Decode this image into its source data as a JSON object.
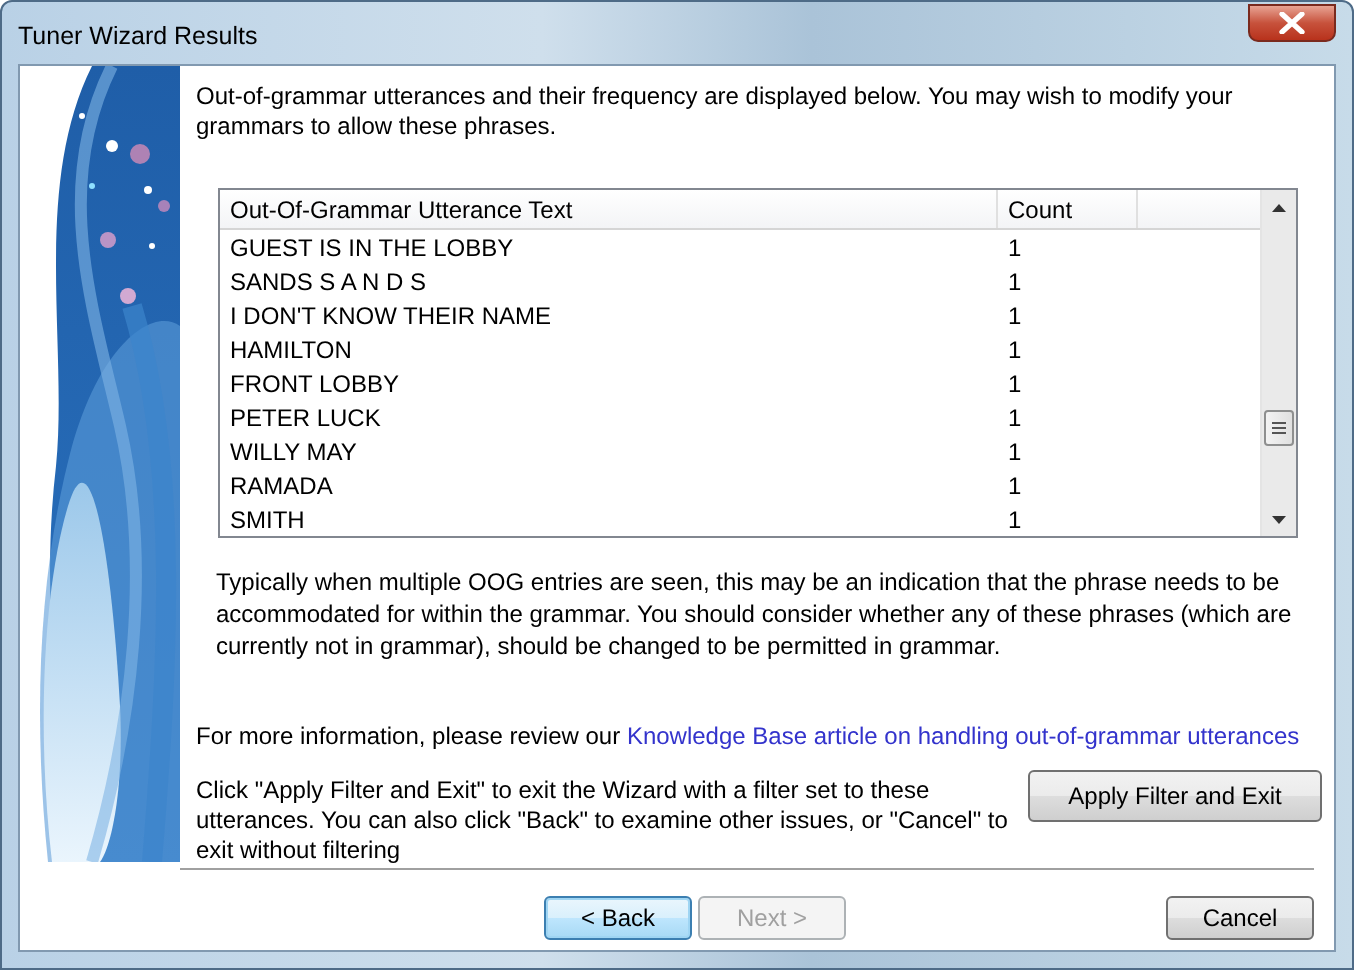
{
  "window": {
    "title": "Tuner Wizard Results"
  },
  "intro": "Out-of-grammar utterances and their frequency are displayed below. You may wish to modify your grammars to allow these phrases.",
  "table": {
    "columns": [
      "Out-Of-Grammar Utterance Text",
      "Count"
    ],
    "rows": [
      {
        "text": "GUEST IS IN THE LOBBY",
        "count": "1"
      },
      {
        "text": "SANDS S A N D S",
        "count": "1"
      },
      {
        "text": "I DON'T KNOW THEIR NAME",
        "count": "1"
      },
      {
        "text": "HAMILTON",
        "count": "1"
      },
      {
        "text": "FRONT LOBBY",
        "count": "1"
      },
      {
        "text": "PETER LUCK",
        "count": "1"
      },
      {
        "text": "WILLY MAY",
        "count": "1"
      },
      {
        "text": "RAMADA",
        "count": "1"
      },
      {
        "text": "SMITH",
        "count": "1"
      }
    ]
  },
  "note": "Typically when multiple OOG entries are seen, this may be an indication that the phrase needs to be accommodated for within the grammar. You should consider whether any of these phrases (which are currently not in grammar), should be changed to be permitted in grammar.",
  "info": {
    "text": "For more information, please review our",
    "link": "Knowledge Base article on handling out-of-grammar utterances"
  },
  "instruction": "Click \"Apply Filter and Exit\" to exit the Wizard with a filter set to these utterances. You can also click \"Back\" to examine other issues, or \"Cancel\" to exit without filtering",
  "apply_button": "Apply Filter and Exit",
  "nav_buttons": [
    {
      "label": "< Back",
      "disabled": false,
      "focused": true
    },
    {
      "label": "Next >",
      "disabled": true,
      "focused": false
    },
    {
      "label": "Cancel",
      "disabled": false,
      "focused": false
    }
  ]
}
